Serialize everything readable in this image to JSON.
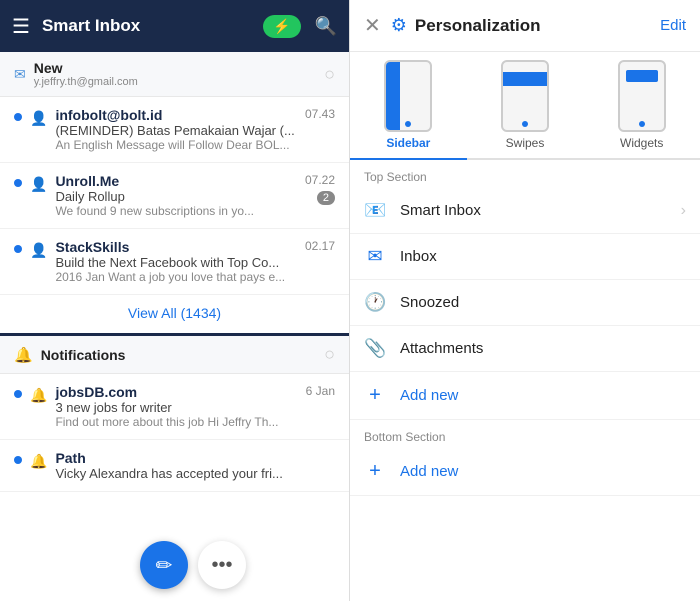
{
  "left_panel": {
    "header": {
      "title": "Smart Inbox",
      "hamburger_label": "☰",
      "search_label": "🔍",
      "power_icon": "⚡"
    },
    "smart_inbox": {
      "title": "New",
      "subtitle": "y.jeffry.th@gmail.com",
      "emails": [
        {
          "sender": "infobolt@bolt.id",
          "time": "07.43",
          "subject": "(REMINDER) Batas Pemakaian Wajar (...",
          "preview": "An English Message will Follow Dear BOL..."
        },
        {
          "sender": "Unroll.Me",
          "time": "07.22",
          "subject": "Daily Rollup",
          "preview": "We found 9 new subscriptions in yo...",
          "badge": "2"
        },
        {
          "sender": "StackSkills",
          "time": "02.17",
          "subject": "Build the Next Facebook with Top Co...",
          "preview": "2016 Jan Want a job you love that pays e..."
        }
      ],
      "view_all": "View All (1434)"
    },
    "notifications": {
      "title": "Notifications",
      "items": [
        {
          "sender": "jobsDB.com",
          "time": "6 Jan",
          "subject": "3 new jobs for writer",
          "preview": "Find out more about this job Hi Jeffry Th..."
        },
        {
          "sender": "Path",
          "time": "",
          "subject": "Vicky Alexandra has accepted your fri...",
          "preview": ""
        }
      ]
    },
    "fab_edit_icon": "✏️",
    "fab_more_icon": "•••"
  },
  "right_panel": {
    "header": {
      "close_label": "✕",
      "title": "Personalization",
      "edit_label": "Edit"
    },
    "tabs": [
      {
        "label": "Sidebar",
        "active": true
      },
      {
        "label": "Swipes",
        "active": false
      },
      {
        "label": "Widgets",
        "active": false
      }
    ],
    "top_section_label": "Top Section",
    "menu_items_top": [
      {
        "icon": "📧",
        "label": "Smart Inbox",
        "has_arrow": true,
        "type": "smart_inbox"
      },
      {
        "icon": "✉️",
        "label": "Inbox",
        "has_arrow": false,
        "type": "inbox"
      },
      {
        "icon": "🕐",
        "label": "Snoozed",
        "has_arrow": false,
        "type": "snoozed"
      },
      {
        "icon": "📎",
        "label": "Attachments",
        "has_arrow": false,
        "type": "attachments"
      },
      {
        "icon": "+",
        "label": "Add new",
        "has_arrow": false,
        "type": "add"
      }
    ],
    "bottom_section_label": "Bottom Section",
    "menu_items_bottom": [
      {
        "icon": "+",
        "label": "Add new",
        "has_arrow": false,
        "type": "add"
      }
    ]
  }
}
